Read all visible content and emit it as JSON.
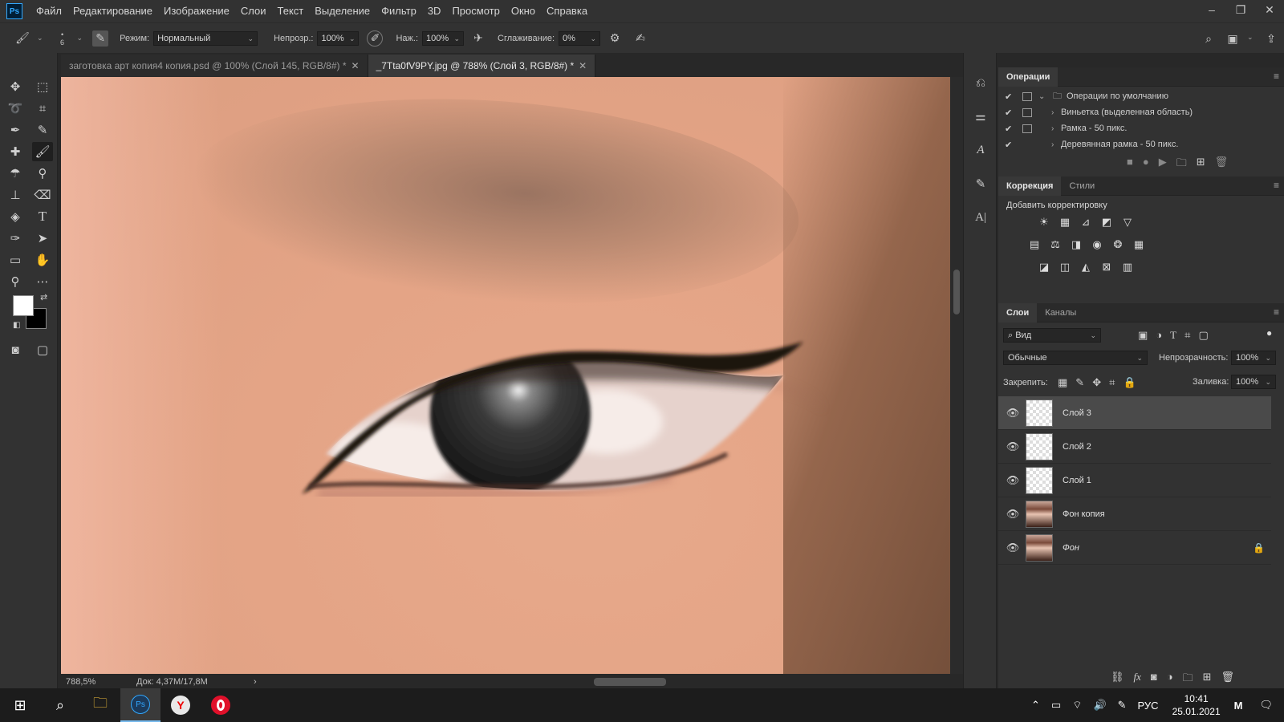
{
  "app": {
    "logo": "Ps"
  },
  "menu": [
    "Файл",
    "Редактирование",
    "Изображение",
    "Слои",
    "Текст",
    "Выделение",
    "Фильтр",
    "3D",
    "Просмотр",
    "Окно",
    "Справка"
  ],
  "window_controls": {
    "minimize": "–",
    "restore": "❐",
    "close": "✕"
  },
  "options": {
    "brush_size": "6",
    "mode_label": "Режим:",
    "mode_value": "Нормальный",
    "opacity_label": "Непрозр.:",
    "opacity_value": "100%",
    "pressure_label": "Наж.:",
    "pressure_value": "100%",
    "smoothing_label": "Сглаживание:",
    "smoothing_value": "0%"
  },
  "tabs": [
    {
      "label": "заготовка арт копия4 копия.psd @ 100% (Слой 145, RGB/8#) *",
      "close": "✕"
    },
    {
      "label": "_7Tta0fV9PY.jpg @ 788% (Слой 3, RGB/8#) *",
      "close": "✕"
    }
  ],
  "status": {
    "zoom": "788,5%",
    "doc": "Док: 4,37M/17,8M",
    "arrow": "›"
  },
  "actions_panel": {
    "title": "Операции",
    "rows": [
      {
        "check": "✔",
        "arrow": "⌄",
        "label": "Операции по умолчанию",
        "folder": true
      },
      {
        "check": "✔",
        "arrow": "›",
        "label": "Виньетка (выделенная область)"
      },
      {
        "check": "✔",
        "arrow": "›",
        "label": "Рамка - 50 пикс."
      },
      {
        "check": "✔",
        "arrow": "›",
        "label": "Деревянная рамка - 50 пикс."
      }
    ]
  },
  "adjustments_panel": {
    "tabs": [
      "Коррекция",
      "Стили"
    ],
    "heading": "Добавить корректировку"
  },
  "layers_panel": {
    "tabs": [
      "Слои",
      "Каналы"
    ],
    "filter_label": "Вид",
    "blend_mode": "Обычные",
    "opacity_label": "Непрозрачность:",
    "opacity_value": "100%",
    "lock_label": "Закрепить:",
    "fill_label": "Заливка:",
    "fill_value": "100%",
    "layers": [
      {
        "name": "Слой 3",
        "selected": true,
        "photo": false
      },
      {
        "name": "Слой 2",
        "selected": false,
        "photo": false
      },
      {
        "name": "Слой 1",
        "selected": false,
        "photo": false
      },
      {
        "name": "Фон копия",
        "selected": false,
        "photo": true
      },
      {
        "name": "Фон",
        "selected": false,
        "photo": true,
        "locked": true,
        "italic": true
      }
    ]
  },
  "taskbar": {
    "lang": "РУС",
    "time": "10:41",
    "date": "25.01.2021"
  },
  "colors": {
    "foreground": "#ffffff",
    "background": "#000000",
    "accent": "#31a8ff"
  }
}
